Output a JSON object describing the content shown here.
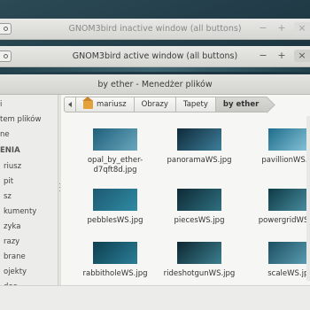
{
  "windows": [
    {
      "title": "GNOM3bird inactive window (all buttons)",
      "controls": {
        "minimize": "−",
        "maximize": "+",
        "close": "×"
      }
    },
    {
      "title": "GNOM3bird active window (all buttons)",
      "controls": {
        "minimize": "−",
        "maximize": "+",
        "close": "×"
      }
    }
  ],
  "file_manager": {
    "title": "by ether - Menedżer plików",
    "sidebar": {
      "items": [
        "i",
        "tem plików",
        "ne"
      ],
      "section": "ENIA",
      "bookmarks": [
        "riusz",
        "pit",
        "sz",
        "kumenty",
        "zyka",
        "razy",
        "brane",
        "ojekty",
        "deo"
      ]
    },
    "pathbar": [
      "mariusz",
      "Obrazy",
      "Tapety",
      "by ether"
    ],
    "files": [
      {
        "name": "opal_by_ether-\nd7qft8d.jpg",
        "colors": [
          "#1f5f7a",
          "#6aa7bd"
        ]
      },
      {
        "name": "panoramaWS.jpg",
        "colors": [
          "#0f2a3a",
          "#3d7f9a"
        ]
      },
      {
        "name": "pavillionWS.jpg",
        "colors": [
          "#1e6d8c",
          "#8ec9dc"
        ]
      },
      {
        "name": "pebblesWS.jpg",
        "colors": [
          "#1d5a72",
          "#2f8aa3"
        ]
      },
      {
        "name": "piecesWS.jpg",
        "colors": [
          "#0e2a35",
          "#2f7080"
        ]
      },
      {
        "name": "powergridWS.jpg",
        "colors": [
          "#0e3a46",
          "#4d93a6"
        ]
      },
      {
        "name": "rabbitholeWS.jpg",
        "colors": [
          "#0e3f50",
          "#2a7e97"
        ]
      },
      {
        "name": "rideshotgunWS.jpg",
        "colors": [
          "#0c2731",
          "#3c7f8f"
        ]
      },
      {
        "name": "scaleWS.jpg",
        "colors": [
          "#1c4f62",
          "#5fa2b7"
        ]
      }
    ]
  }
}
